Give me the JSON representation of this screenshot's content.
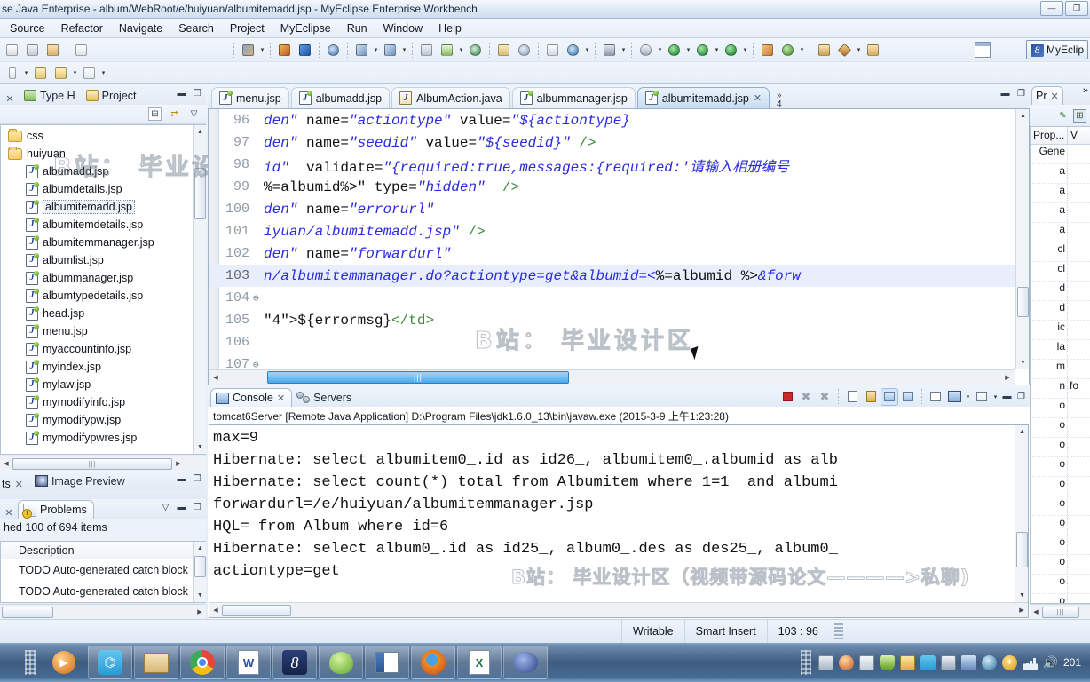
{
  "window": {
    "title": "se Java Enterprise - album/WebRoot/e/huiyuan/albumitemadd.jsp - MyEclipse Enterprise Workbench",
    "minimize": "—",
    "maximize": "❐",
    "close": "✕"
  },
  "menubar": {
    "items": [
      "Source",
      "Refactor",
      "Navigate",
      "Search",
      "Project",
      "MyEclipse",
      "Run",
      "Window",
      "Help"
    ]
  },
  "toolbar": {
    "perspective_button": "MyEclip",
    "icons": [
      "new-wizard-icon",
      "save-icon",
      "save-all-icon",
      "print-icon",
      "build-icon",
      "new-web-project-icon",
      "deploy-icon",
      "db-browser-icon",
      "new-server-icon",
      "run-server-icon",
      "open-type-icon",
      "search-icon",
      "external-tools-icon",
      "run-icon",
      "debug-icon",
      "profile-icon",
      "next-annotation-icon",
      "previous-annotation-icon",
      "back-icon",
      "forward-icon"
    ]
  },
  "explorer": {
    "tabs": [
      {
        "label": "Type H",
        "icon": "type-hierarchy-icon",
        "active": false
      },
      {
        "label": "Project",
        "icon": "project-explorer-icon",
        "active": false
      }
    ],
    "close_label": "✕",
    "tree": [
      {
        "label": "css",
        "type": "folder",
        "indent": 0,
        "selected": false
      },
      {
        "label": "huiyuan",
        "type": "folder",
        "indent": 0,
        "selected": false
      },
      {
        "label": "albumadd.jsp",
        "type": "jsp",
        "indent": 1,
        "selected": false
      },
      {
        "label": "albumdetails.jsp",
        "type": "jsp",
        "indent": 1,
        "selected": false
      },
      {
        "label": "albumitemadd.jsp",
        "type": "jsp",
        "indent": 1,
        "selected": true
      },
      {
        "label": "albumitemdetails.jsp",
        "type": "jsp",
        "indent": 1,
        "selected": false
      },
      {
        "label": "albumitemmanager.jsp",
        "type": "jsp",
        "indent": 1,
        "selected": false
      },
      {
        "label": "albumlist.jsp",
        "type": "jsp",
        "indent": 1,
        "selected": false
      },
      {
        "label": "albummanager.jsp",
        "type": "jsp",
        "indent": 1,
        "selected": false
      },
      {
        "label": "albumtypedetails.jsp",
        "type": "jsp",
        "indent": 1,
        "selected": false
      },
      {
        "label": "head.jsp",
        "type": "jsp",
        "indent": 1,
        "selected": false
      },
      {
        "label": "menu.jsp",
        "type": "jsp",
        "indent": 1,
        "selected": false
      },
      {
        "label": "myaccountinfo.jsp",
        "type": "jsp",
        "indent": 1,
        "selected": false
      },
      {
        "label": "myindex.jsp",
        "type": "jsp",
        "indent": 1,
        "selected": false
      },
      {
        "label": "mylaw.jsp",
        "type": "jsp",
        "indent": 1,
        "selected": false
      },
      {
        "label": "mymodifyinfo.jsp",
        "type": "jsp",
        "indent": 1,
        "selected": false
      },
      {
        "label": "mymodifypw.jsp",
        "type": "jsp",
        "indent": 1,
        "selected": false
      },
      {
        "label": "mymodifypwres.jsp",
        "type": "jsp",
        "indent": 1,
        "selected": false
      }
    ]
  },
  "image_preview": {
    "tab_label": "Image Preview",
    "left_tab_label": "ts",
    "close_label": "✕"
  },
  "problems": {
    "tab_label": "Problems",
    "close_label": "✕",
    "count_text": "hed 100 of 694 items",
    "column_header": "Description",
    "rows": [
      "TODO Auto-generated catch block",
      "TODO Auto-generated catch block"
    ]
  },
  "editor": {
    "tabs": [
      {
        "label": "menu.jsp",
        "icon": "jsp-file-icon",
        "active": false
      },
      {
        "label": "albumadd.jsp",
        "icon": "jsp-file-icon",
        "active": false
      },
      {
        "label": "AlbumAction.java",
        "icon": "java-file-icon",
        "active": false
      },
      {
        "label": "albummanager.jsp",
        "icon": "jsp-file-icon",
        "active": false
      },
      {
        "label": "albumitemadd.jsp",
        "icon": "jsp-file-icon",
        "active": true
      }
    ],
    "active_close_label": "✕",
    "overflow_chevron": "»",
    "overflow_count": "4",
    "lines": [
      {
        "num": "96",
        "fold": "",
        "highlight": false,
        "segments": [
          {
            "t": "den\" ",
            "c": "k-str"
          },
          {
            "t": "name=",
            "c": "k-plain"
          },
          {
            "t": "\"actiontype\" ",
            "c": "k-str"
          },
          {
            "t": "value=",
            "c": "k-plain"
          },
          {
            "t": "\"${actiontype}",
            "c": "k-str"
          }
        ]
      },
      {
        "num": "97",
        "fold": "",
        "highlight": false,
        "segments": [
          {
            "t": "den\" ",
            "c": "k-str"
          },
          {
            "t": "name=",
            "c": "k-plain"
          },
          {
            "t": "\"seedid\" ",
            "c": "k-str"
          },
          {
            "t": "value=",
            "c": "k-plain"
          },
          {
            "t": "\"${seedid}\" ",
            "c": "k-str"
          },
          {
            "t": "/>",
            "c": "k-green"
          }
        ]
      },
      {
        "num": "98",
        "fold": "",
        "highlight": false,
        "segments": [
          {
            "t": "id\"  ",
            "c": "k-str"
          },
          {
            "t": "validate=",
            "c": "k-plain"
          },
          {
            "t": "\"{required:true,messages:{required:'请输入相册编号",
            "c": "k-str"
          }
        ]
      },
      {
        "num": "99",
        "fold": "",
        "highlight": false,
        "segments": [
          {
            "t": "%=albumid%>\" ",
            "c": "k-plain"
          },
          {
            "t": "type=",
            "c": "k-plain"
          },
          {
            "t": "\"hidden\"  ",
            "c": "k-str"
          },
          {
            "t": "/>",
            "c": "k-green"
          }
        ]
      },
      {
        "num": "100",
        "fold": "",
        "highlight": false,
        "segments": [
          {
            "t": "den\" ",
            "c": "k-str"
          },
          {
            "t": "name=",
            "c": "k-plain"
          },
          {
            "t": "\"errorurl\"",
            "c": "k-str"
          }
        ]
      },
      {
        "num": "101",
        "fold": "",
        "highlight": false,
        "segments": [
          {
            "t": "iyuan/albumitemadd.jsp\" ",
            "c": "k-str"
          },
          {
            "t": "/>",
            "c": "k-green"
          }
        ]
      },
      {
        "num": "102",
        "fold": "",
        "highlight": false,
        "segments": [
          {
            "t": "den\" ",
            "c": "k-str"
          },
          {
            "t": "name=",
            "c": "k-plain"
          },
          {
            "t": "\"forwardurl\"",
            "c": "k-str"
          }
        ]
      },
      {
        "num": "103",
        "fold": "",
        "highlight": true,
        "segments": [
          {
            "t": "n/albumitemmanager.do?actiontype=get&albumid=<",
            "c": "k-str"
          },
          {
            "t": "%=albumid %>",
            "c": "k-plain"
          },
          {
            "t": "&forw",
            "c": "k-str"
          }
        ]
      },
      {
        "num": "104",
        "fold": "⊖",
        "highlight": false,
        "segments": []
      },
      {
        "num": "105",
        "fold": "",
        "highlight": false,
        "segments": [
          {
            "t": "\"4\">",
            "c": "k-plain"
          },
          {
            "t": "${errormsg}",
            "c": "k-plain"
          },
          {
            "t": "</td>",
            "c": "k-green"
          }
        ]
      },
      {
        "num": "106",
        "fold": "",
        "highlight": false,
        "segments": []
      },
      {
        "num": "107",
        "fold": "⊖",
        "highlight": false,
        "segments": []
      }
    ],
    "hscroll_grip": "|||"
  },
  "console": {
    "tabs": [
      {
        "label": "Console",
        "icon": "console-icon",
        "active": true
      },
      {
        "label": "Servers",
        "icon": "servers-icon",
        "active": false
      }
    ],
    "close_label": "✕",
    "launch_line": "tomcat6Server [Remote Java Application] D:\\Program Files\\jdk1.6.0_13\\bin\\javaw.exe (2015-3-9 上午1:23:28)",
    "lines": [
      "max=9",
      "Hibernate: select albumitem0_.id as id26_, albumitem0_.albumid as alb",
      "Hibernate: select count(*) total from Albumitem where 1=1  and albumi",
      "forwardurl=/e/huiyuan/albumitemmanager.jsp",
      "HQL= from Album where id=6",
      "Hibernate: select album0_.id as id25_, album0_.des as des25_, album0_",
      "actiontype=get"
    ],
    "toolbar_icons": [
      "terminate-icon",
      "remove-launch-icon",
      "remove-all-launches-icon",
      "clear-console-icon",
      "scroll-lock-icon",
      "show-console-on-output-icon",
      "show-console-on-error-icon",
      "pin-console-icon",
      "display-selected-console-icon",
      "open-console-icon",
      "minimize-icon",
      "maximize-icon"
    ]
  },
  "properties": {
    "tab_label": "Pr",
    "close_label": "✕",
    "overflow_chevron": "»",
    "columns": [
      "Prop...",
      "V"
    ],
    "rows": [
      {
        "name": "Gene",
        "value": ""
      },
      {
        "name": "a",
        "value": ""
      },
      {
        "name": "a",
        "value": ""
      },
      {
        "name": "a",
        "value": ""
      },
      {
        "name": "a",
        "value": ""
      },
      {
        "name": "cl",
        "value": ""
      },
      {
        "name": "cl",
        "value": ""
      },
      {
        "name": "d",
        "value": ""
      },
      {
        "name": "d",
        "value": ""
      },
      {
        "name": "ic",
        "value": ""
      },
      {
        "name": "la",
        "value": ""
      },
      {
        "name": "m",
        "value": ""
      },
      {
        "name": "n",
        "value": "fo"
      },
      {
        "name": "o",
        "value": ""
      },
      {
        "name": "o",
        "value": ""
      },
      {
        "name": "o",
        "value": ""
      },
      {
        "name": "o",
        "value": ""
      },
      {
        "name": "o",
        "value": ""
      },
      {
        "name": "o",
        "value": ""
      },
      {
        "name": "o",
        "value": ""
      },
      {
        "name": "o",
        "value": ""
      },
      {
        "name": "o",
        "value": ""
      },
      {
        "name": "o",
        "value": ""
      },
      {
        "name": "o",
        "value": ""
      }
    ]
  },
  "statusbar": {
    "writable": "Writable",
    "insert_mode": "Smart Insert",
    "cursor_position": "103 : 96"
  },
  "taskbar": {
    "items": [
      "media-player-icon",
      "baidu-cloud-icon",
      "file-explorer-icon",
      "chrome-icon",
      "word-icon",
      "navicat-icon",
      "emule-icon",
      "notepad-icon",
      "firefox-icon",
      "excel-icon",
      "sql-server-icon"
    ],
    "tray_icons": [
      "keyboard-icon",
      "qq-icon",
      "clipboard-icon",
      "shield-icon",
      "windows-icon",
      "baidu-icon",
      "network-settings-icon",
      "update-icon",
      "globe-icon",
      "plus-icon",
      "signal-icon",
      "volume-icon"
    ],
    "clock": "201"
  },
  "watermarks": {
    "tree": "B站： 毕业设计区",
    "editor_top": "B站： 毕业设计区",
    "editor_mid": "B站： 毕业设计区",
    "console": "B站： 毕业设计区（视频带源码论文————>私聊)"
  },
  "colors": {
    "accent": "#2b7fc0",
    "string": "#2a2ae0",
    "tag": "#1a1aa8",
    "highlight_row": "#e8eefb",
    "taskbar": "#3f5c80"
  }
}
